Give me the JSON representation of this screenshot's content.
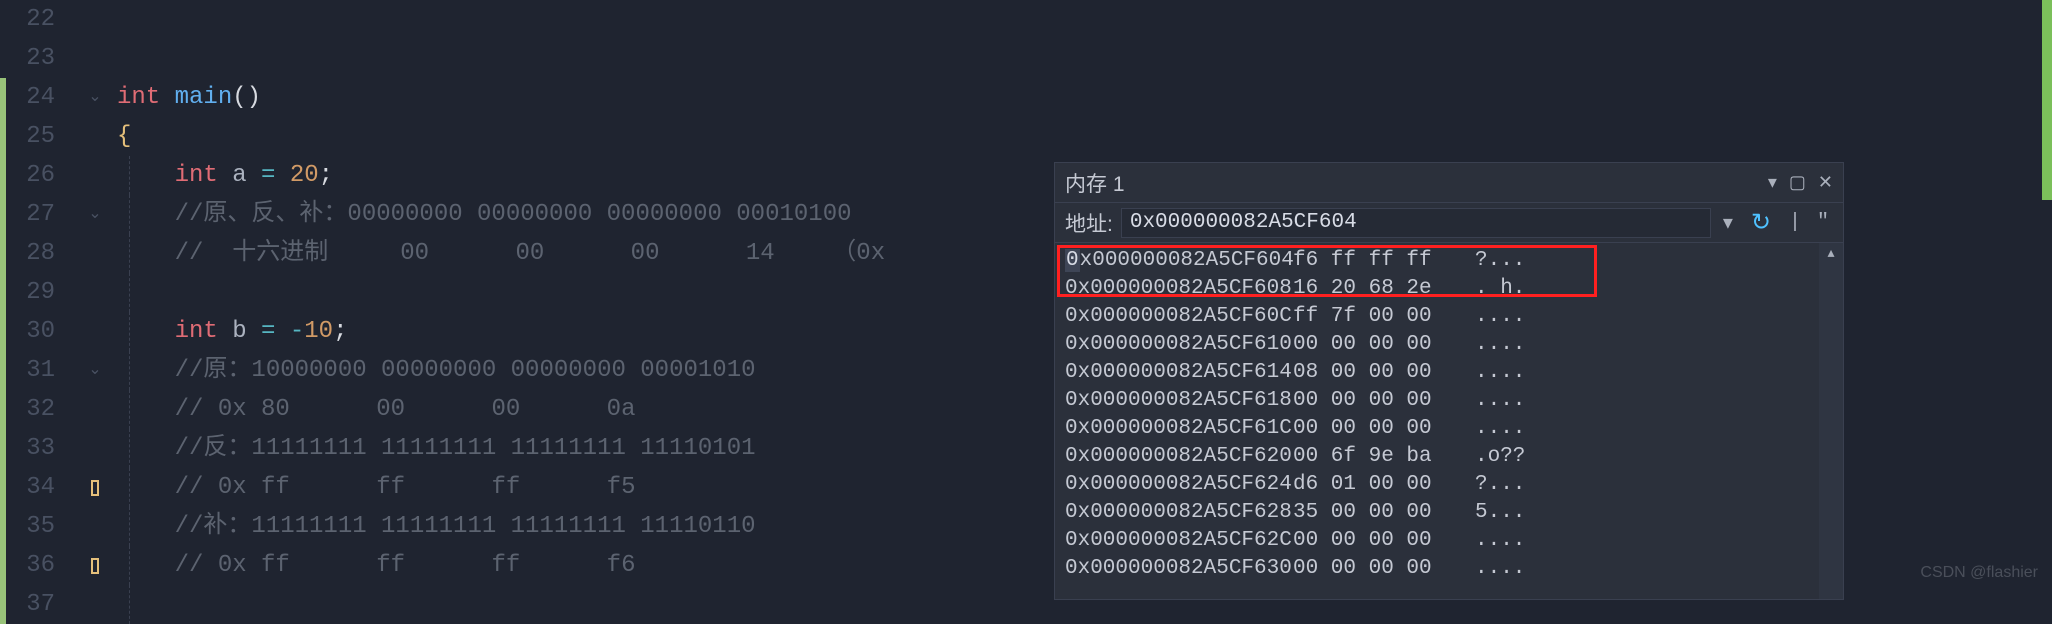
{
  "editor": {
    "lines": [
      {
        "num": "22",
        "c": ""
      },
      {
        "num": "23",
        "c": ""
      },
      {
        "num": "24",
        "c": "int main()",
        "fold": true
      },
      {
        "num": "25",
        "c": "{"
      },
      {
        "num": "26",
        "c": "    int a = 20;"
      },
      {
        "num": "27",
        "c": "    //原、反、补：00000000 00000000 00000000 00010100",
        "fold": true
      },
      {
        "num": "28",
        "c": "    //  十六进制     00      00      00      14    （0x "
      },
      {
        "num": "29",
        "c": ""
      },
      {
        "num": "30",
        "c": "    int b = -10;"
      },
      {
        "num": "31",
        "c": "    //原：10000000 00000000 00000000 00001010",
        "fold": true
      },
      {
        "num": "32",
        "c": "    // 0x 80      00      00      0a"
      },
      {
        "num": "33",
        "c": "    //反：11111111 11111111 11111111 11110101"
      },
      {
        "num": "34",
        "c": "    // 0x ff      ff      ff      f5",
        "marker": "yellow"
      },
      {
        "num": "35",
        "c": "    //补：11111111 11111111 11111111 11110110"
      },
      {
        "num": "36",
        "c": "    // 0x ff      ff      ff      f6",
        "marker": "yellow"
      },
      {
        "num": "37",
        "c": ""
      }
    ],
    "code_tokens": {
      "l24": [
        {
          "t": "int",
          "c": "type"
        },
        {
          "t": " "
        },
        {
          "t": "main",
          "c": "fn"
        },
        {
          "t": "()",
          "c": "punct"
        }
      ],
      "l25": [
        {
          "t": "{",
          "c": "brace"
        }
      ],
      "l26": [
        {
          "t": "    "
        },
        {
          "t": "int",
          "c": "type"
        },
        {
          "t": " a ",
          "c": "var"
        },
        {
          "t": "=",
          "c": "op"
        },
        {
          "t": " "
        },
        {
          "t": "20",
          "c": "num"
        },
        {
          "t": ";",
          "c": "punct"
        }
      ],
      "l27": [
        {
          "t": "    "
        },
        {
          "t": "//原、反、补：00000000 00000000 00000000 00010100",
          "c": "comment"
        }
      ],
      "l28": [
        {
          "t": "    "
        },
        {
          "t": "//  十六进制     00      00      00      14    （0x ",
          "c": "comment"
        }
      ],
      "l30": [
        {
          "t": "    "
        },
        {
          "t": "int",
          "c": "type"
        },
        {
          "t": " b ",
          "c": "var"
        },
        {
          "t": "=",
          "c": "op"
        },
        {
          "t": " "
        },
        {
          "t": "-",
          "c": "op"
        },
        {
          "t": "10",
          "c": "num"
        },
        {
          "t": ";",
          "c": "punct"
        }
      ],
      "l31": [
        {
          "t": "    "
        },
        {
          "t": "//原：10000000 00000000 00000000 00001010",
          "c": "comment"
        }
      ],
      "l32": [
        {
          "t": "    "
        },
        {
          "t": "// 0x 80      00      00      0a",
          "c": "comment"
        }
      ],
      "l33": [
        {
          "t": "    "
        },
        {
          "t": "//反：11111111 11111111 11111111 11110101",
          "c": "comment"
        }
      ],
      "l34": [
        {
          "t": "    "
        },
        {
          "t": "// 0x ff      ff      ff      f5",
          "c": "comment"
        }
      ],
      "l35": [
        {
          "t": "    "
        },
        {
          "t": "//补：11111111 11111111 11111111 11110110",
          "c": "comment"
        }
      ],
      "l36": [
        {
          "t": "    "
        },
        {
          "t": "// 0x ff      ff      ff      f6",
          "c": "comment"
        }
      ]
    }
  },
  "memory": {
    "title": "内存 1",
    "address_label": "地址:",
    "address_value": "0x000000082A5CF604",
    "rows": [
      {
        "addr": "0x000000082A5CF604",
        "bytes": "f6 ff ff ff",
        "ascii": "?..."
      },
      {
        "addr": "0x000000082A5CF608",
        "bytes": "16 20 68 2e",
        "ascii": ". h."
      },
      {
        "addr": "0x000000082A5CF60C",
        "bytes": "ff 7f 00 00",
        "ascii": "...."
      },
      {
        "addr": "0x000000082A5CF610",
        "bytes": "00 00 00 00",
        "ascii": "...."
      },
      {
        "addr": "0x000000082A5CF614",
        "bytes": "08 00 00 00",
        "ascii": "...."
      },
      {
        "addr": "0x000000082A5CF618",
        "bytes": "00 00 00 00",
        "ascii": "...."
      },
      {
        "addr": "0x000000082A5CF61C",
        "bytes": "00 00 00 00",
        "ascii": "...."
      },
      {
        "addr": "0x000000082A5CF620",
        "bytes": "00 6f 9e ba",
        "ascii": ".o??"
      },
      {
        "addr": "0x000000082A5CF624",
        "bytes": "d6 01 00 00",
        "ascii": "?..."
      },
      {
        "addr": "0x000000082A5CF628",
        "bytes": "35 00 00 00",
        "ascii": "5..."
      },
      {
        "addr": "0x000000082A5CF62C",
        "bytes": "00 00 00 00",
        "ascii": "...."
      },
      {
        "addr": "0x000000082A5CF630",
        "bytes": "00 00 00 00",
        "ascii": "...."
      }
    ]
  },
  "watermark": "CSDN @flashier"
}
